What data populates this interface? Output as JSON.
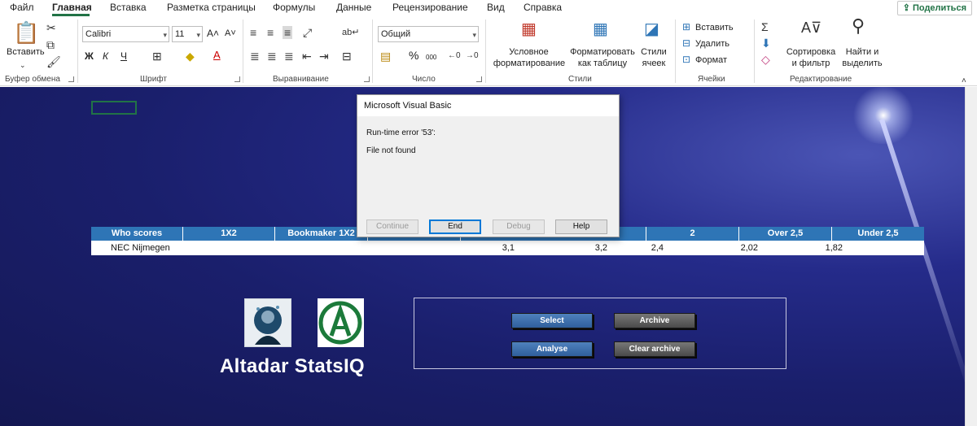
{
  "tabs": [
    "Файл",
    "Главная",
    "Вставка",
    "Разметка страницы",
    "Формулы",
    "Данные",
    "Рецензирование",
    "Вид",
    "Справка"
  ],
  "share_label": "Поделиться",
  "share_icon": "share-icon",
  "ribbon": {
    "clipboard": {
      "paste_label": "Вставить",
      "group_label": "Буфер обмена"
    },
    "font": {
      "name": "Calibri",
      "size": "11",
      "bold": "Ж",
      "italic": "К",
      "underline": "Ч",
      "group_label": "Шрифт"
    },
    "alignment": {
      "group_label": "Выравнивание"
    },
    "number": {
      "format": "Общий",
      "percent": "%",
      "thousands": "000",
      "group_label": "Число"
    },
    "styles": {
      "conditional_1": "Условное",
      "conditional_2": "форматирование",
      "format_table_1": "Форматировать",
      "format_table_2": "как таблицу",
      "cell_styles_1": "Стили",
      "cell_styles_2": "ячеек",
      "group_label": "Стили"
    },
    "cells": {
      "insert": "Вставить",
      "delete": "Удалить",
      "format": "Формат",
      "group_label": "Ячейки"
    },
    "editing": {
      "sort_1": "Сортировка",
      "sort_2": "и фильтр",
      "find_1": "Найти и",
      "find_2": "выделить",
      "group_label": "Редактирование"
    }
  },
  "table": {
    "headers": [
      "Who scores",
      "1X2",
      "Bookmaker 1X2",
      "",
      "",
      "2",
      "Over 2,5",
      "Under 2,5"
    ],
    "row": [
      "NEC Nijmegen",
      "",
      "",
      "3,1",
      "3,2",
      "2,4",
      "2,02",
      "1,82"
    ]
  },
  "brand": "Altadar StatsIQ",
  "macro_buttons": {
    "select": "Select",
    "archive": "Archive",
    "analyse": "Analyse",
    "clear_archive": "Clear archive"
  },
  "dialog": {
    "title": "Microsoft Visual Basic",
    "message_1": "Run-time error '53':",
    "message_2": "File not found",
    "buttons": {
      "continue": "Continue",
      "end": "End",
      "debug": "Debug",
      "help": "Help"
    }
  },
  "colors": {
    "accent": "#217346",
    "table_header": "#2e75b6",
    "sheet_bg": "#1a1f6c"
  }
}
